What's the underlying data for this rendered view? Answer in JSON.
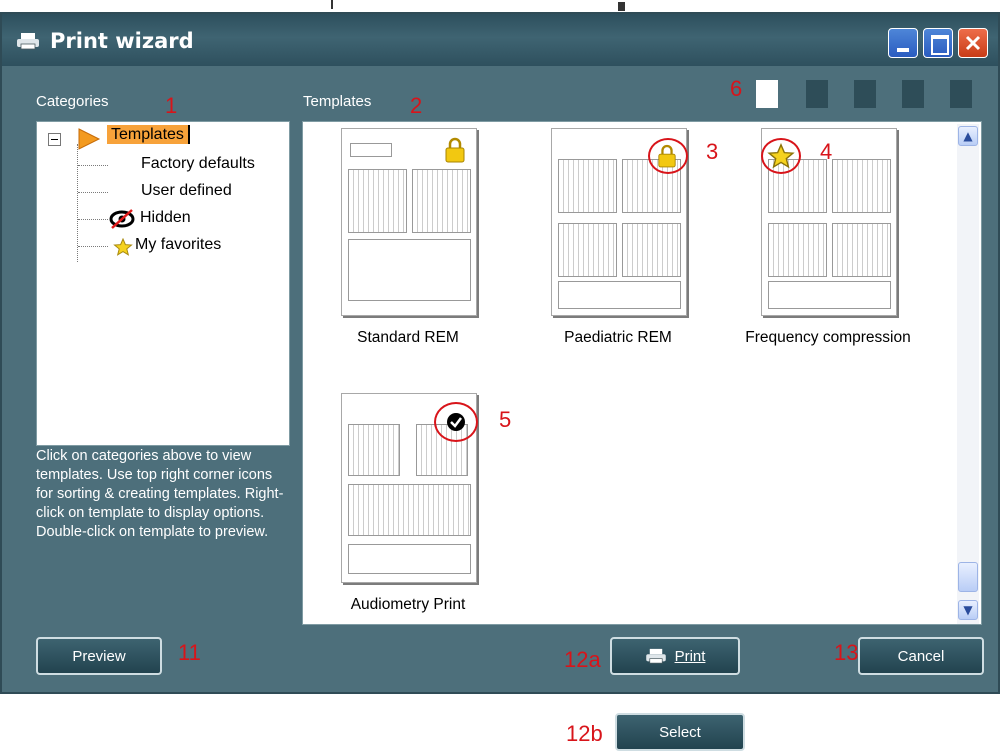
{
  "window": {
    "title": "Print wizard"
  },
  "categories": {
    "label": "Categories",
    "tree": [
      {
        "label": "Templates",
        "selected": true,
        "icon": "arrow-icon"
      },
      {
        "label": "Factory defaults"
      },
      {
        "label": "User defined"
      },
      {
        "label": "Hidden",
        "icon": "hidden-eye-icon"
      },
      {
        "label": "My favorites",
        "icon": "star-icon"
      }
    ],
    "help": "Click on categories above to view templates. Use top right corner icons for sorting & creating templates. Right-click on template to display options. Double-click on template to preview."
  },
  "templates": {
    "label": "Templates",
    "items": [
      {
        "name": "Standard REM",
        "badge": "lock-icon"
      },
      {
        "name": "Paediatric REM",
        "badge": "lock-icon"
      },
      {
        "name": "Frequency compression",
        "badge": "star-icon"
      },
      {
        "name": "Audiometry Print",
        "badge": "check-icon"
      }
    ]
  },
  "callouts": [
    "1",
    "2",
    "3",
    "4",
    "5",
    "6",
    "11",
    "12a",
    "13",
    "12b"
  ],
  "buttons": {
    "preview": "Preview",
    "print": "Print",
    "cancel": "Cancel",
    "select": "Select"
  },
  "colors": {
    "accent": "#d8141a",
    "window": "#4d6f7b",
    "selection": "#f7a23a"
  }
}
